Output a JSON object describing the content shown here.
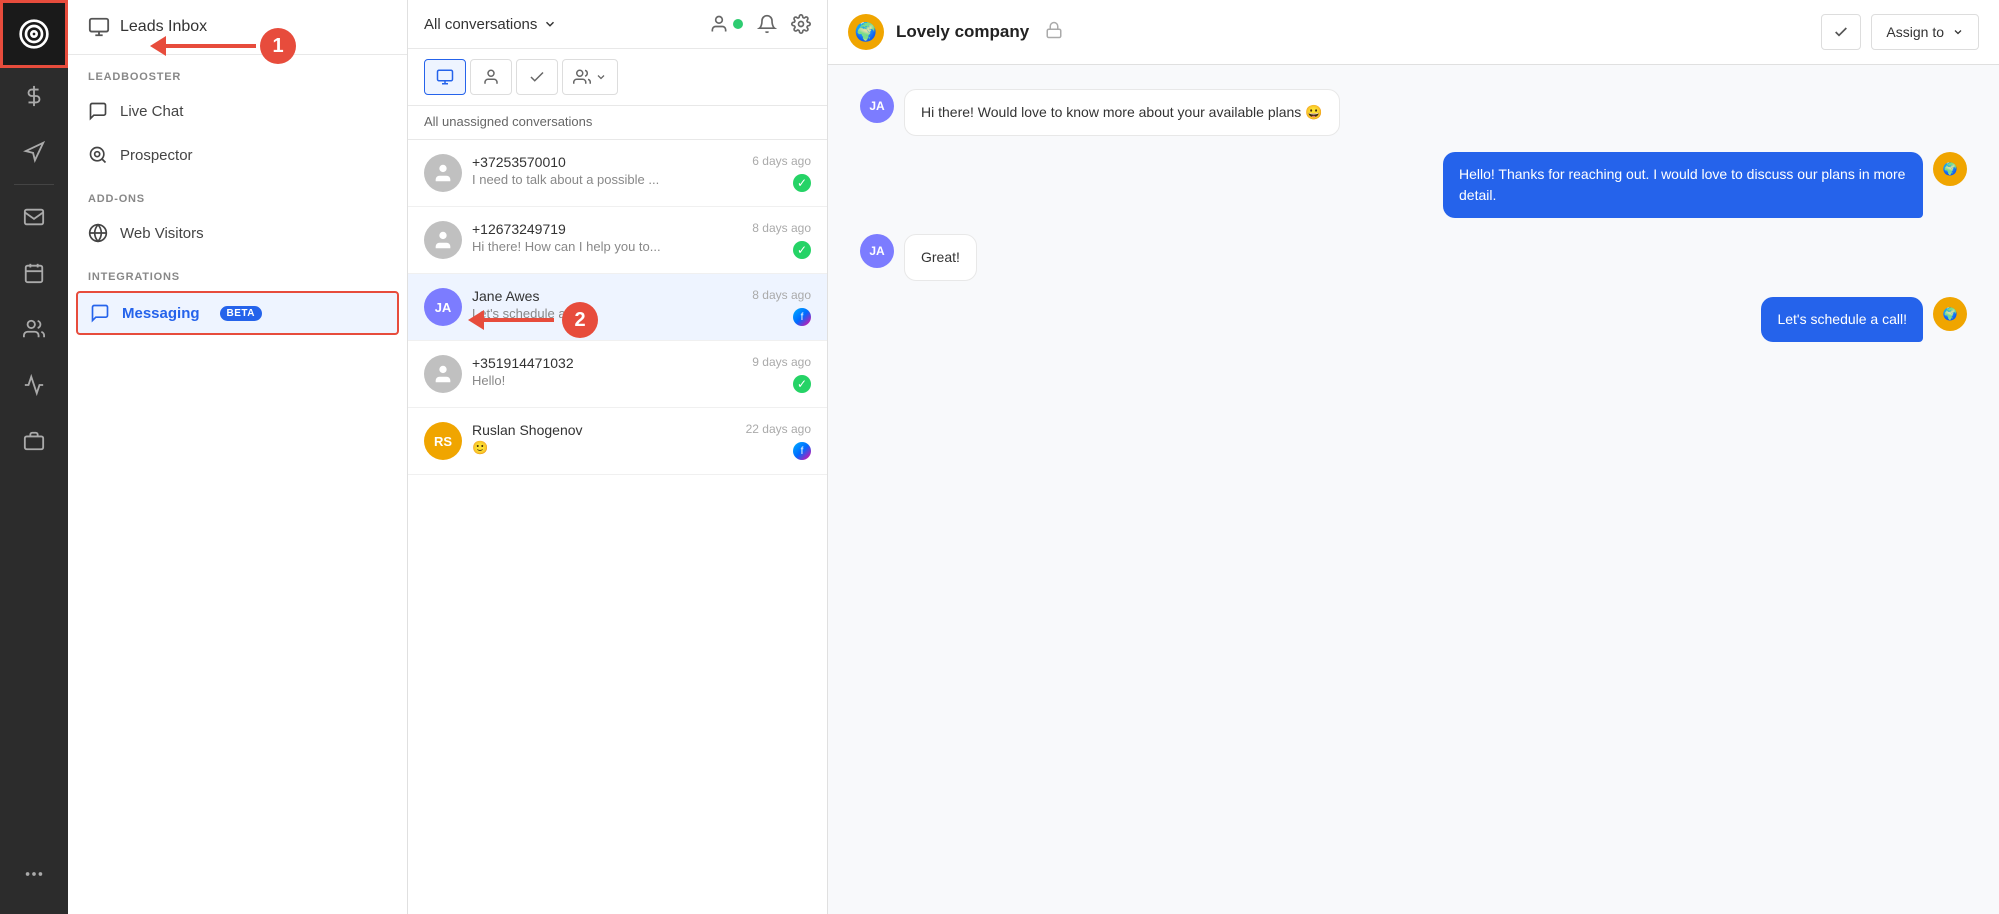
{
  "nav": {
    "items": [
      {
        "id": "target",
        "icon": "target-icon",
        "label": "Target"
      },
      {
        "id": "dollar",
        "icon": "dollar-icon",
        "label": "Revenue"
      },
      {
        "id": "megaphone",
        "icon": "megaphone-icon",
        "label": "Campaigns"
      },
      {
        "id": "mail",
        "icon": "mail-icon",
        "label": "Mail"
      },
      {
        "id": "calendar",
        "icon": "calendar-icon",
        "label": "Calendar"
      },
      {
        "id": "contacts",
        "icon": "contacts-icon",
        "label": "Contacts"
      },
      {
        "id": "analytics",
        "icon": "analytics-icon",
        "label": "Analytics"
      },
      {
        "id": "products",
        "icon": "products-icon",
        "label": "Products"
      },
      {
        "id": "more",
        "icon": "more-icon",
        "label": "More"
      }
    ]
  },
  "sidebar": {
    "leads_inbox": "Leads Inbox",
    "leadbooster_label": "LEADBOOSTER",
    "live_chat": "Live Chat",
    "prospector": "Prospector",
    "addons_label": "ADD-ONS",
    "web_visitors": "Web Visitors",
    "integrations_label": "INTEGRATIONS",
    "messaging": "Messaging",
    "beta_label": "BETA"
  },
  "conv_panel": {
    "header_title": "All conversations",
    "sub_label": "All unassigned conversations",
    "conversations": [
      {
        "id": "c1",
        "avatar_initials": "",
        "avatar_type": "user",
        "name": "+37253570010",
        "preview": "I need to talk about a possible ...",
        "time": "6 days ago",
        "channel": "whatsapp"
      },
      {
        "id": "c2",
        "avatar_initials": "",
        "avatar_type": "user",
        "name": "+12673249719",
        "preview": "Hi there! How can I help you to...",
        "time": "8 days ago",
        "channel": "whatsapp"
      },
      {
        "id": "c3",
        "avatar_initials": "JA",
        "avatar_type": "ja",
        "name": "Jane Awes",
        "preview": "Let's schedule a call!",
        "time": "8 days ago",
        "channel": "messenger",
        "active": true
      },
      {
        "id": "c4",
        "avatar_initials": "",
        "avatar_type": "user",
        "name": "+351914471032",
        "preview": "Hello!",
        "time": "9 days ago",
        "channel": "whatsapp"
      },
      {
        "id": "c5",
        "avatar_initials": "RS",
        "avatar_type": "rs",
        "name": "Ruslan Shogenov",
        "preview": "🙂",
        "time": "22 days ago",
        "channel": "messenger"
      }
    ]
  },
  "chat": {
    "company_name": "Lovely company",
    "assign_label": "Assign to",
    "messages": [
      {
        "id": "m1",
        "direction": "incoming",
        "avatar": "JA",
        "text": "Hi there! Would love to know more about your available plans 😀"
      },
      {
        "id": "m2",
        "direction": "outgoing",
        "text": "Hello! Thanks for reaching out. I would love to discuss our plans in more detail."
      },
      {
        "id": "m3",
        "direction": "incoming",
        "avatar": "JA",
        "text": "Great!"
      },
      {
        "id": "m4",
        "direction": "outgoing",
        "text": "Let's schedule a call!"
      }
    ]
  },
  "annotations": {
    "arrow1_number": "1",
    "arrow2_number": "2"
  }
}
